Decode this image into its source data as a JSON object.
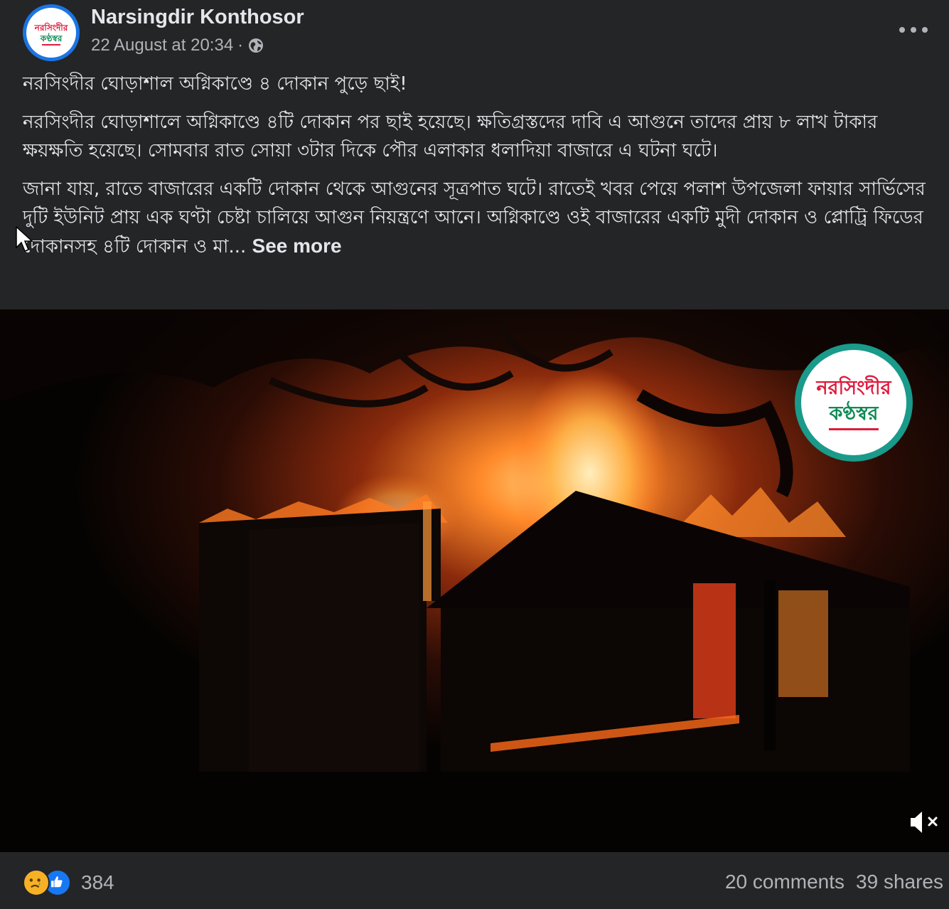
{
  "post": {
    "author": "Narsingdir Konthosor",
    "timestamp": "22 August at 20:34",
    "separator": "·",
    "audience_icon": "globe-icon",
    "headline": "নরসিংদীর ঘোড়াশাল অগ্নিকাণ্ডে ৪ দোকান পুড়ে ছাই!",
    "paragraph1": "নরসিংদীর ঘোড়াশালে অগ্নিকাণ্ডে ৪টি দোকান পর ছাই হয়েছে। ক্ষতিগ্রস্তদের দাবি এ আগুনে তাদের প্রায় ৮ লাখ টাকার ক্ষয়ক্ষতি হয়েছে। সোমবার রাত সোয়া ৩টার দিকে পৌর এলাকার ধলাদিয়া বাজারে এ ঘটনা ঘটে।",
    "paragraph2": "জানা যায়, রাতে বাজারের একটি দোকান থেকে আগুনের সূত্রপাত ঘটে। রাতেই খবর পেয়ে পলাশ উপজেলা ফায়ার সার্ভিসের দুটি ইউনিট প্রায় এক ঘণ্টা চেষ্টা চালিয়ে আগুন নিয়ন্ত্রণে আনে। অগ্নিকাণ্ডে ওই বাজারের একটি মুদী দোকান ও প্লোট্রি ফিডের দোকানসহ ৪টি দোকান ও মা...",
    "see_more": "See more"
  },
  "avatar": {
    "line1": "নরসিংদীর",
    "line2": "কণ্ঠস্বর"
  },
  "video": {
    "watermark_line1": "নরসিংদীর",
    "watermark_line2": "কণ্ঠস্বর",
    "muted": true
  },
  "footer": {
    "reactions": [
      "sad-icon",
      "like-icon"
    ],
    "reaction_count": "384",
    "comments": "20 comments",
    "shares": "39 shares"
  },
  "colors": {
    "background": "#242526",
    "text_primary": "#e4e6eb",
    "text_secondary": "#b0b3b8",
    "accent": "#1b74e4"
  }
}
